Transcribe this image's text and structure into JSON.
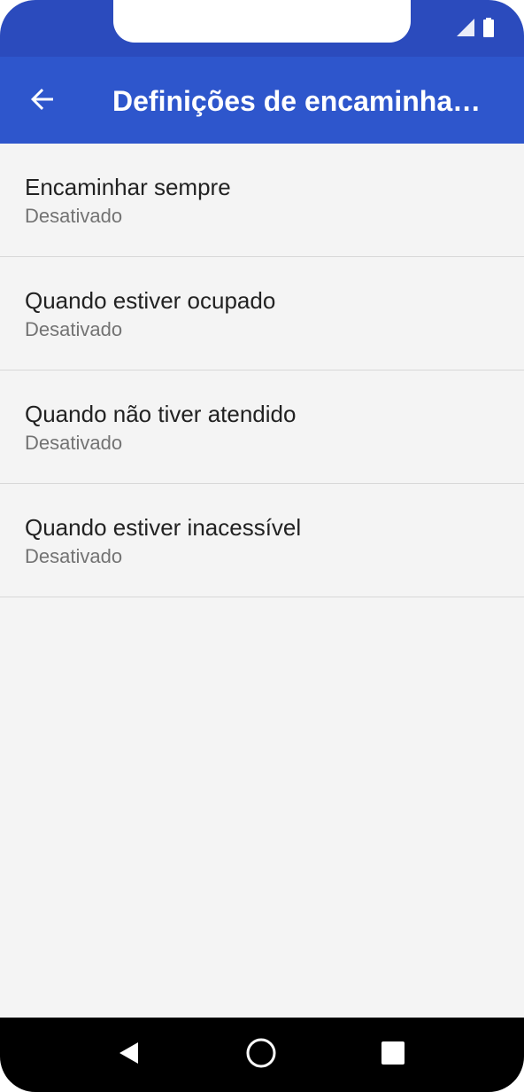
{
  "app_bar": {
    "title": "Definições de encaminha…",
    "back_icon": "arrow-back-icon"
  },
  "status_bar": {
    "icons": [
      "signal-icon",
      "battery-icon"
    ]
  },
  "settings": {
    "items": [
      {
        "title": "Encaminhar sempre",
        "summary": "Desativado"
      },
      {
        "title": "Quando estiver ocupado",
        "summary": "Desativado"
      },
      {
        "title": "Quando não tiver atendido",
        "summary": "Desativado"
      },
      {
        "title": "Quando estiver inacessível",
        "summary": "Desativado"
      }
    ]
  },
  "nav_bar": {
    "icons": [
      "nav-back-icon",
      "nav-home-icon",
      "nav-recents-icon"
    ]
  },
  "colors": {
    "status_bar": "#2b4bbd",
    "app_bar": "#2e56cc",
    "background": "#f4f4f4"
  }
}
